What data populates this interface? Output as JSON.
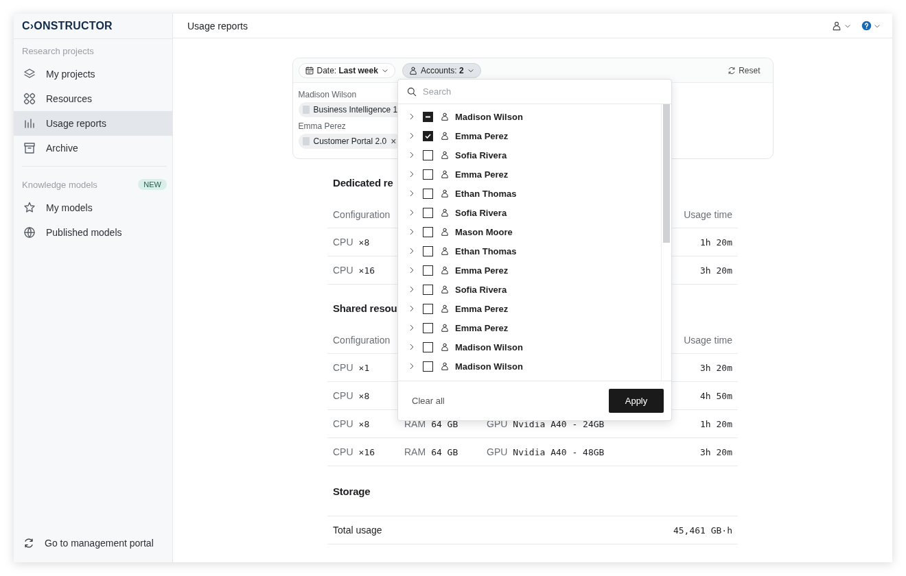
{
  "logo": "C›ONSTRUCTOR",
  "sidebar": {
    "sections": [
      {
        "title": "Research projects",
        "items": [
          {
            "label": "My projects",
            "kind": "layers",
            "selected": false
          },
          {
            "label": "Resources",
            "kind": "grid",
            "selected": false
          },
          {
            "label": "Usage reports",
            "kind": "bars",
            "selected": true
          },
          {
            "label": "Archive",
            "kind": "archive",
            "selected": false
          }
        ]
      },
      {
        "title": "Knowledge models",
        "badge": "NEW",
        "items": [
          {
            "label": "My models",
            "kind": "model",
            "selected": false
          },
          {
            "label": "Published models",
            "kind": "globe",
            "selected": false
          }
        ]
      }
    ],
    "footer": {
      "label": "Go to management portal"
    }
  },
  "header": {
    "title": "Usage reports"
  },
  "filters": {
    "chips": [
      {
        "kind": "date",
        "label": "Date:",
        "value": "Last week",
        "selected": false
      },
      {
        "kind": "accounts",
        "label": "Accounts:",
        "value": "2",
        "selected": true
      }
    ],
    "reset": "Reset",
    "groups": [
      {
        "name": "Madison Wilson",
        "tags": [
          {
            "label": "Business Intelligence 1"
          }
        ]
      },
      {
        "name": "Emma Perez",
        "tags": [
          {
            "label": "Customer Portal 2.0",
            "remove": "×"
          }
        ]
      }
    ]
  },
  "sections": [
    {
      "title": "Dedicated re",
      "columns": {
        "config": "Configuration",
        "usage": "Usage time"
      },
      "rows": [
        {
          "cpu_label": "CPU",
          "cpu_value": "×8",
          "usage": "1h 20m"
        },
        {
          "cpu_label": "CPU",
          "cpu_value": "×16",
          "usage": "3h 20m"
        }
      ]
    },
    {
      "title": "Shared resou",
      "columns": {
        "config": "Configuration",
        "usage": "Usage time"
      },
      "rows": [
        {
          "cpu_label": "CPU",
          "cpu_value": "×1",
          "usage": "3h 20m"
        },
        {
          "cpu_label": "CPU",
          "cpu_value": "×8",
          "usage": "4h 50m"
        },
        {
          "cpu_label": "CPU",
          "cpu_value": "×8",
          "ram_label": "RAM",
          "ram_value": "64 GB",
          "gpu_label": "GPU",
          "gpu_value": "Nvidia A40 - 24GB",
          "usage": "1h 20m"
        },
        {
          "cpu_label": "CPU",
          "cpu_value": "×16",
          "ram_label": "RAM",
          "ram_value": "64 GB",
          "gpu_label": "GPU",
          "gpu_value": "Nvidia A40 - 48GB",
          "usage": "3h 20m"
        }
      ]
    }
  ],
  "storage": {
    "title": "Storage",
    "rows": [
      {
        "label": "Total usage",
        "value": "45,461 GB·h"
      }
    ]
  },
  "dropdown": {
    "search": {
      "placeholder": "Search"
    },
    "items": [
      {
        "name": "Madison Wilson",
        "checked": false,
        "indeterminate": true
      },
      {
        "name": "Emma Perez",
        "checked": true,
        "indeterminate": false
      },
      {
        "name": "Sofia Rivera",
        "checked": false,
        "indeterminate": false
      },
      {
        "name": "Emma Perez",
        "checked": false,
        "indeterminate": false
      },
      {
        "name": "Ethan Thomas",
        "checked": false,
        "indeterminate": false
      },
      {
        "name": "Sofia Rivera",
        "checked": false,
        "indeterminate": false
      },
      {
        "name": "Mason Moore",
        "checked": false,
        "indeterminate": false
      },
      {
        "name": "Ethan Thomas",
        "checked": false,
        "indeterminate": false
      },
      {
        "name": "Emma Perez",
        "checked": false,
        "indeterminate": false
      },
      {
        "name": "Sofia Rivera",
        "checked": false,
        "indeterminate": false
      },
      {
        "name": "Emma Perez",
        "checked": false,
        "indeterminate": false
      },
      {
        "name": "Emma Perez",
        "checked": false,
        "indeterminate": false
      },
      {
        "name": "Madison Wilson",
        "checked": false,
        "indeterminate": false
      },
      {
        "name": "Madison Wilson",
        "checked": false,
        "indeterminate": false
      }
    ],
    "clear": "Clear all",
    "apply": "Apply"
  }
}
